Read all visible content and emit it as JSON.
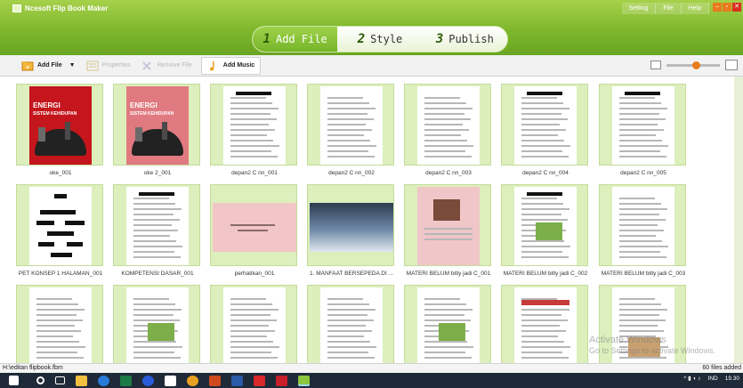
{
  "app": {
    "title": "Ncesoft Flip Book Maker"
  },
  "top_menu": [
    "Setting",
    "File",
    "Help"
  ],
  "steps": [
    {
      "num": "1",
      "label": "Add File"
    },
    {
      "num": "2",
      "label": "Style"
    },
    {
      "num": "3",
      "label": "Publish"
    }
  ],
  "toolbar": {
    "add_file": "Add File",
    "properties": "Properties",
    "remove_file": "Remove File",
    "add_music": "Add Music"
  },
  "zoom_level": 0.55,
  "thumbnails": [
    {
      "caption": "oke_001"
    },
    {
      "caption": "oke 2_001"
    },
    {
      "caption": "depan2 C nn_001"
    },
    {
      "caption": "depan2 C nn_002"
    },
    {
      "caption": "depan2 C nn_003"
    },
    {
      "caption": "depan2 C nn_004"
    },
    {
      "caption": "depan2 C nn_005"
    },
    {
      "caption": "PET KONSEP 1 HALAMAN_001"
    },
    {
      "caption": "KOMPETENSI DASAR_001"
    },
    {
      "caption": "perhatikan_001"
    },
    {
      "caption": "1. MANFAAT BERSEPEDA DI ..."
    },
    {
      "caption": "MATERI BELUM bitly jadi C_001"
    },
    {
      "caption": "MATERI BELUM bitly jadi C_002"
    },
    {
      "caption": "MATERI BELUM bitly jadi C_003"
    },
    {
      "caption": ""
    },
    {
      "caption": ""
    },
    {
      "caption": ""
    },
    {
      "caption": ""
    },
    {
      "caption": ""
    },
    {
      "caption": ""
    },
    {
      "caption": ""
    }
  ],
  "cover": {
    "title_line1": "ENERGI",
    "title_line2": "SISTEM KEHIDUPAN"
  },
  "status": {
    "path": "H:\\editan flipbook.fbm",
    "count": "60 files added"
  },
  "watermark": {
    "line1": "Activate Windows",
    "line2": "Go to Settings to activate Windows."
  },
  "tray": {
    "lang": "IND",
    "time": "19.30"
  },
  "colors": {
    "header_green": "#7ab52a",
    "frame_green": "#dcefbd",
    "accent_orange": "#e87b1c"
  }
}
